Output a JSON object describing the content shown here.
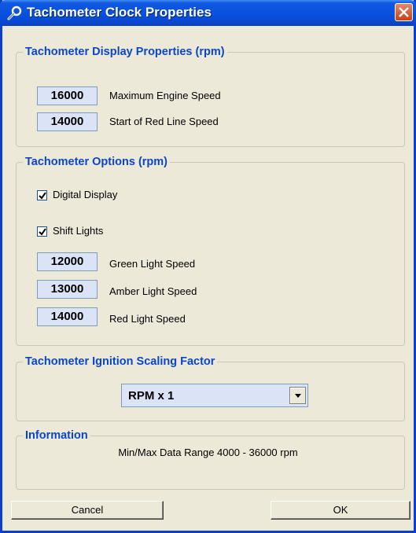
{
  "window": {
    "title": "Tachometer Clock Properties"
  },
  "display_group": {
    "legend": "Tachometer Display Properties (rpm)",
    "fields": [
      {
        "value": "16000",
        "label": "Maximum Engine Speed"
      },
      {
        "value": "14000",
        "label": "Start of Red Line Speed"
      }
    ]
  },
  "options_group": {
    "legend": "Tachometer Options (rpm)",
    "digital_display": {
      "label": "Digital Display",
      "checked": true
    },
    "shift_lights": {
      "label": "Shift Lights",
      "checked": true
    },
    "fields": [
      {
        "value": "12000",
        "label": "Green Light Speed"
      },
      {
        "value": "13000",
        "label": "Amber Light Speed"
      },
      {
        "value": "14000",
        "label": "Red Light Speed"
      }
    ]
  },
  "scaling_group": {
    "legend": "Tachometer Ignition Scaling Factor",
    "selected": "RPM x 1"
  },
  "info_group": {
    "legend": "Information",
    "text": "Min/Max Data Range 4000 - 36000 rpm"
  },
  "buttons": {
    "cancel": "Cancel",
    "ok": "OK"
  },
  "icons": {
    "title": "wrench-icon",
    "close": "close-icon",
    "dropdown": "chevron-down-icon",
    "check": "checkmark-icon"
  },
  "colors": {
    "titlebar": "#0651df",
    "legend": "#0a46cc",
    "field_bg": "#dbe4f6",
    "dialog_bg": "#ece9d8",
    "close": "#d9522c"
  }
}
